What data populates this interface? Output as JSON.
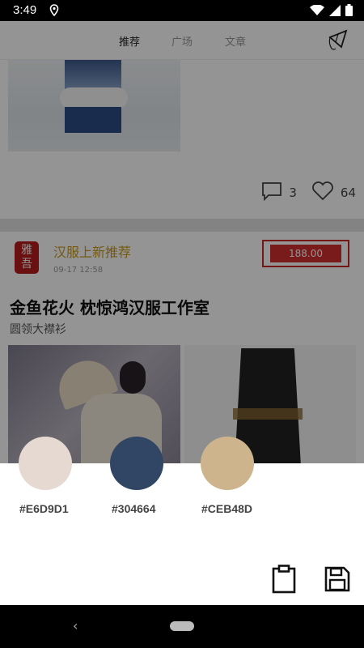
{
  "status": {
    "time": "3:49"
  },
  "tabs": [
    "推荐",
    "广场",
    "文章"
  ],
  "post1": {
    "comments": "3",
    "likes": "64"
  },
  "post2": {
    "logo_text": "雅\n吾",
    "publisher": "汉服上新推荐",
    "date": "09-17 12:58",
    "price": "188.00",
    "title": "金鱼花火 枕惊鸿汉服工作室",
    "subtitle": "圆领大襟衫"
  },
  "palette": [
    {
      "hex": "#E6D9D1",
      "color": "#E6D9D1"
    },
    {
      "hex": "#304664",
      "color": "#304664"
    },
    {
      "hex": "#CEB48D",
      "color": "#CEB48D"
    }
  ],
  "actions": {
    "copy_icon": "clipboard-icon",
    "save_icon": "save-icon"
  },
  "navbar": {
    "back": "‹"
  }
}
